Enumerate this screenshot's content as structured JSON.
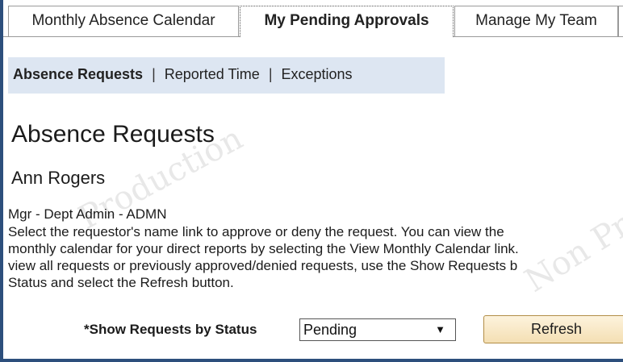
{
  "tabs": [
    {
      "label": "Monthly Absence Calendar"
    },
    {
      "label": "My Pending Approvals",
      "active": true
    },
    {
      "label": "Manage My Team"
    }
  ],
  "subnav": {
    "items": [
      "Absence Requests",
      "Reported Time",
      "Exceptions"
    ],
    "separator": "|"
  },
  "page": {
    "title": "Absence Requests",
    "employee_name": "Ann Rogers",
    "department": "Mgr - Dept Admin - ADMN",
    "instructions": [
      "Select the requestor's name link to approve or deny the request. You can view the",
      "monthly calendar for your direct reports by selecting the View Monthly Calendar link.",
      "view all requests or previously approved/denied requests, use the Show Requests b",
      "Status and select the Refresh button."
    ]
  },
  "filter": {
    "label": "*Show Requests by Status",
    "selected_value": "Pending",
    "arrow_glyph": "▼"
  },
  "refresh_button": {
    "label": "Refresh"
  },
  "watermark": {
    "left": "Production",
    "right": "Non Prod"
  },
  "colors": {
    "border_accent": "#2d4f7c",
    "subnav_background": "#dde6f2",
    "button_background": "#f4dfb3"
  }
}
